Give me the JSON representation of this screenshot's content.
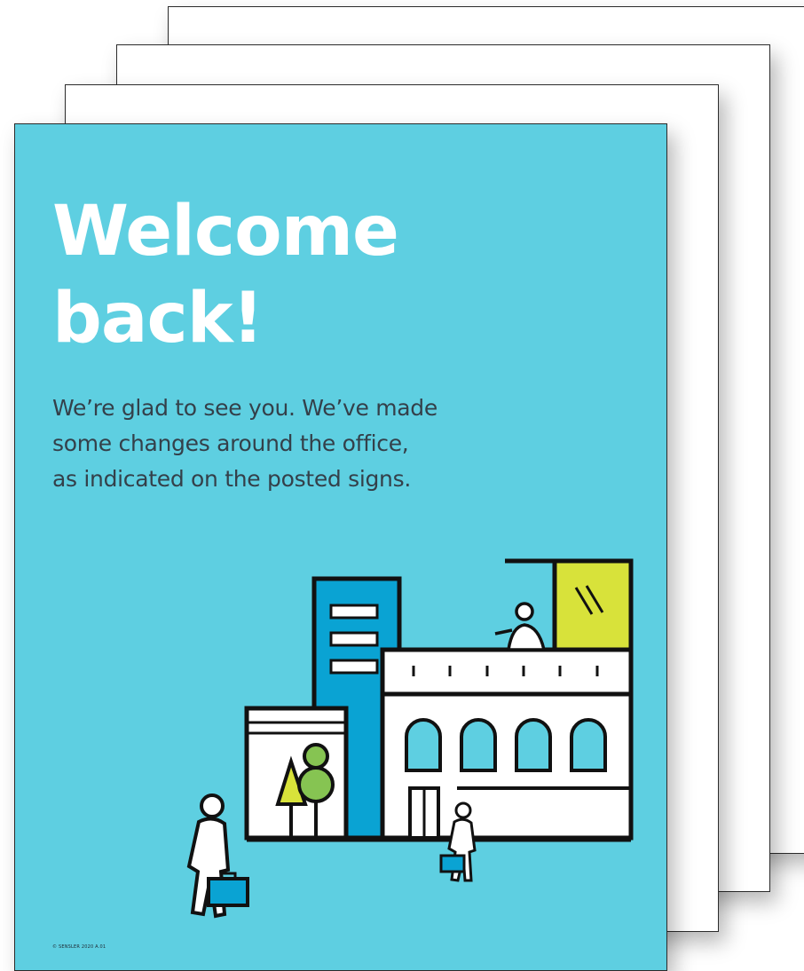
{
  "poster": {
    "headline_line1": "Welcome",
    "headline_line2": "back!",
    "body_line1": "We’re glad to see you. We’ve made",
    "body_line2": "some changes around the office,",
    "body_line3": "as indicated on the posted signs.",
    "footer": "© SENSLER 2020   A.01"
  },
  "colors": {
    "background": "#5ecfe1",
    "headline": "#ffffff",
    "body_text": "#34404a",
    "tower_blue": "#0aa3d3",
    "window_yellow": "#d8e23a",
    "tree_green": "#86c452",
    "outline": "#111111"
  }
}
